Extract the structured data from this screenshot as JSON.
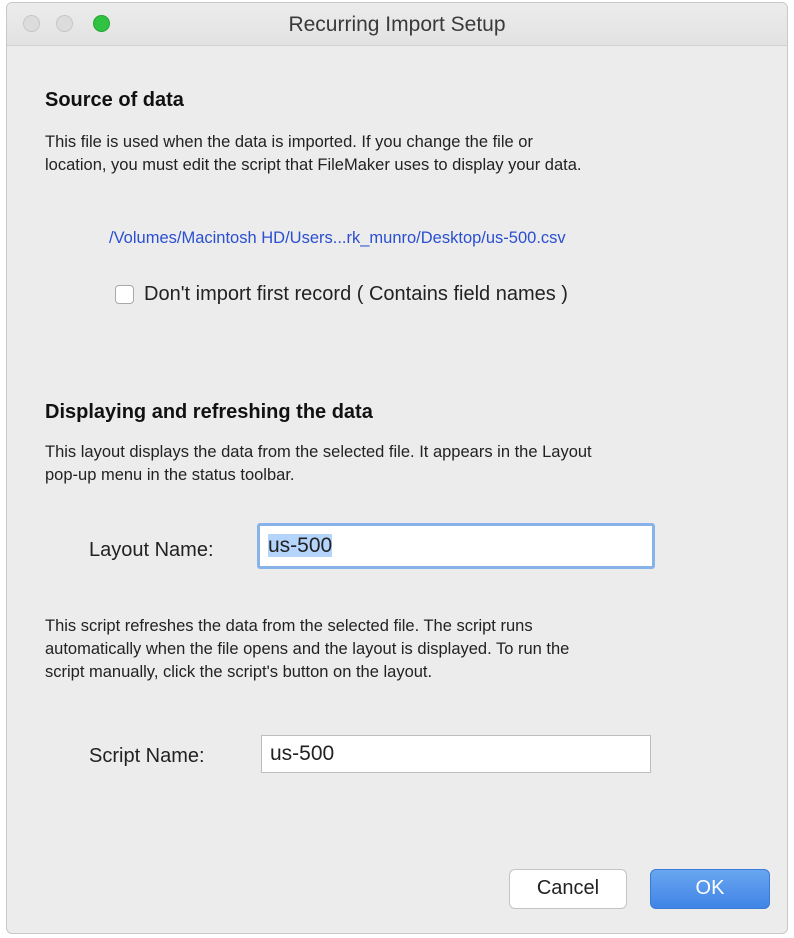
{
  "window": {
    "title": "Recurring Import Setup"
  },
  "source": {
    "heading": "Source of data",
    "description_line1": "This file is used when the data is imported. If you change the file or",
    "description_line2": "location, you must edit the script that FileMaker uses to display your data.",
    "file_path": "/Volumes/Macintosh HD/Users...rk_munro/Desktop/us-500.csv",
    "checkbox_label": "Don't import first record ( Contains field names )",
    "checkbox_checked": false
  },
  "display": {
    "heading": "Displaying and refreshing the data",
    "layout_desc_line1": "This layout displays the data from the selected file. It appears in the Layout",
    "layout_desc_line2": "pop-up menu in the status toolbar.",
    "layout_name_label": "Layout Name:",
    "layout_name_value": "us-500",
    "script_desc_line1": "This script refreshes the data from the selected file. The script runs",
    "script_desc_line2": "automatically when the file opens and the layout is displayed. To run the",
    "script_desc_line3": "script manually, click the script's button on the layout.",
    "script_name_label": "Script Name:",
    "script_name_value": "us-500"
  },
  "buttons": {
    "cancel": "Cancel",
    "ok": "OK"
  },
  "colors": {
    "link": "#2a4fd1",
    "ok_button": "#3f84e6",
    "focus_ring": "#88b3ea",
    "zoom_light": "#2fc341"
  }
}
